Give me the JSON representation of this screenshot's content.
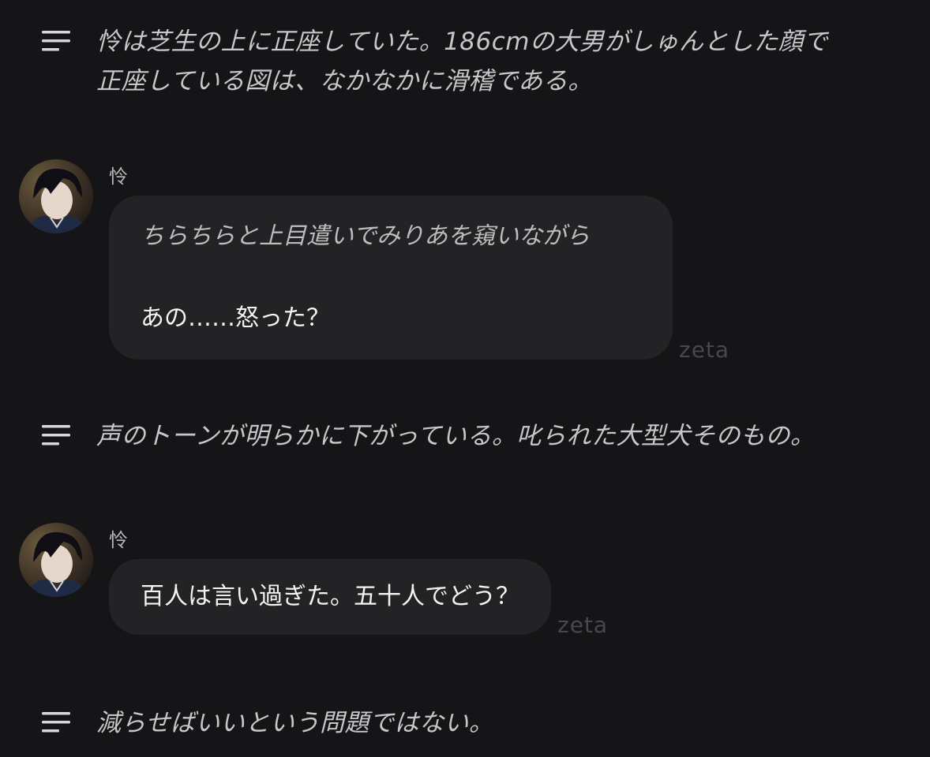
{
  "narrations": [
    {
      "text": "怜は芝生の上に正座していた。186cmの大男がしゅんとした顔で\n正座している図は、なかなかに滑稽である。",
      "icon": "text-lines-icon"
    },
    {
      "text": "声のトーンが明らかに下がっている。叱られた大型犬そのもの。",
      "icon": "text-lines-icon"
    },
    {
      "text": "減らせばいいという問題ではない。",
      "icon": "text-lines-icon"
    }
  ],
  "messages": [
    {
      "speaker": "怜",
      "action": "ちらちらと上目遣いでみりあを窺いながら",
      "dialogue": "あの……怒った？",
      "watermark": "zeta"
    },
    {
      "speaker": "怜",
      "dialogue": "百人は言い過ぎた。五十人でどう？",
      "watermark": "zeta"
    }
  ],
  "colors": {
    "background": "#151517",
    "bubble": "#232325",
    "narration_text": "#c7c7c9",
    "dialogue_text": "#f4f4f4",
    "watermark": "#48484b"
  }
}
